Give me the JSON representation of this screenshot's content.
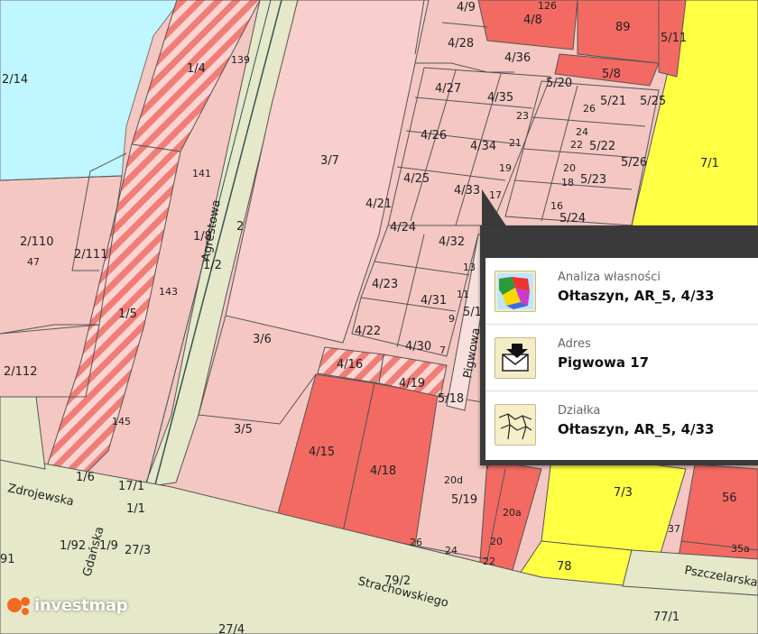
{
  "map": {
    "parcels": [
      "2/14",
      "1/4",
      "139",
      "4/9",
      "4/8",
      "126",
      "89",
      "5/11",
      "4/28",
      "4/36",
      "5/8",
      "4/27",
      "4/35",
      "5/20",
      "26",
      "5/21",
      "5/25",
      "23",
      "4/26",
      "4/34",
      "21",
      "24",
      "22",
      "5/22",
      "3/7",
      "19",
      "20",
      "18",
      "5/23",
      "5/26",
      "7/1",
      "4/25",
      "4/33",
      "17",
      "16",
      "5/24",
      "141",
      "2/110",
      "47",
      "2/111",
      "4/21",
      "4/24",
      "1/8",
      "2",
      "4/32",
      "1/2",
      "13",
      "4/23",
      "4/31",
      "1/5",
      "143",
      "11",
      "5/1",
      "9",
      "4/22",
      "4/30",
      "7",
      "3/6",
      "4/16",
      "4/19",
      "5/18",
      "2/112",
      "145",
      "3/5",
      "4/15",
      "4/18",
      "20d",
      "5/19",
      "20a",
      "7/3",
      "56",
      "1/6",
      "17/1",
      "1/1",
      "1/92",
      "1/9",
      "27/3",
      "26",
      "24",
      "20",
      "22",
      "37",
      "35a",
      "78",
      "79/2",
      "77/1",
      "27/4",
      "91"
    ],
    "streets": [
      "Agrestowa",
      "Pigwowa",
      "Strachowskiego",
      "Pszczelarska",
      "Gdańska",
      "Zdrojewska"
    ]
  },
  "popup": {
    "rows": [
      {
        "title": "Analiza własności",
        "value": "Ołtaszyn, AR_5, 4/33"
      },
      {
        "title": "Adres",
        "value": "Pigwowa 17"
      },
      {
        "title": "Działka",
        "value": "Ołtaszyn, AR_5, 4/33"
      }
    ]
  },
  "brand": {
    "name": "investmap"
  },
  "colors": {
    "residential": "#f4c7c3",
    "dense": "#f26a62",
    "service": "#ffff44",
    "water": "#bff6ff",
    "road": "#e5e8c9",
    "hatch": "#f07e77"
  }
}
